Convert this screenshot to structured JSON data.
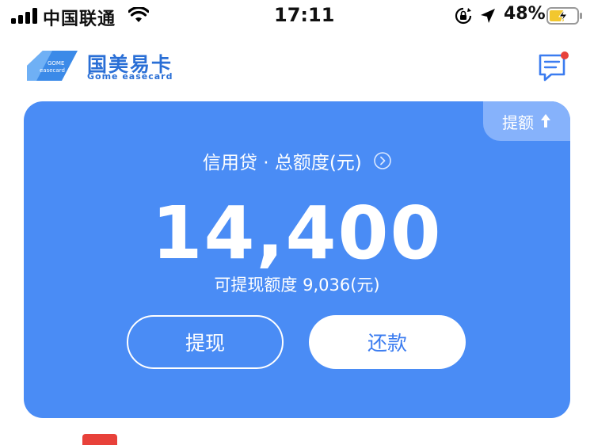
{
  "status_bar": {
    "carrier": "中国联通",
    "time": "17:11",
    "battery_percent": "48%"
  },
  "header": {
    "logo_cn": "国美易卡",
    "logo_en": "Gome easecard",
    "logo_badge_text": "Gome easecard"
  },
  "card": {
    "raise_label": "提额",
    "title": "信用贷 · 总额度(元)",
    "amount": "14,400",
    "available": "可提现额度 9,036(元)",
    "withdraw_label": "提现",
    "repay_label": "还款"
  },
  "colors": {
    "card_bg": "#4a8cf5",
    "accent": "#2a6fd6",
    "badge_red": "#e8413a"
  }
}
